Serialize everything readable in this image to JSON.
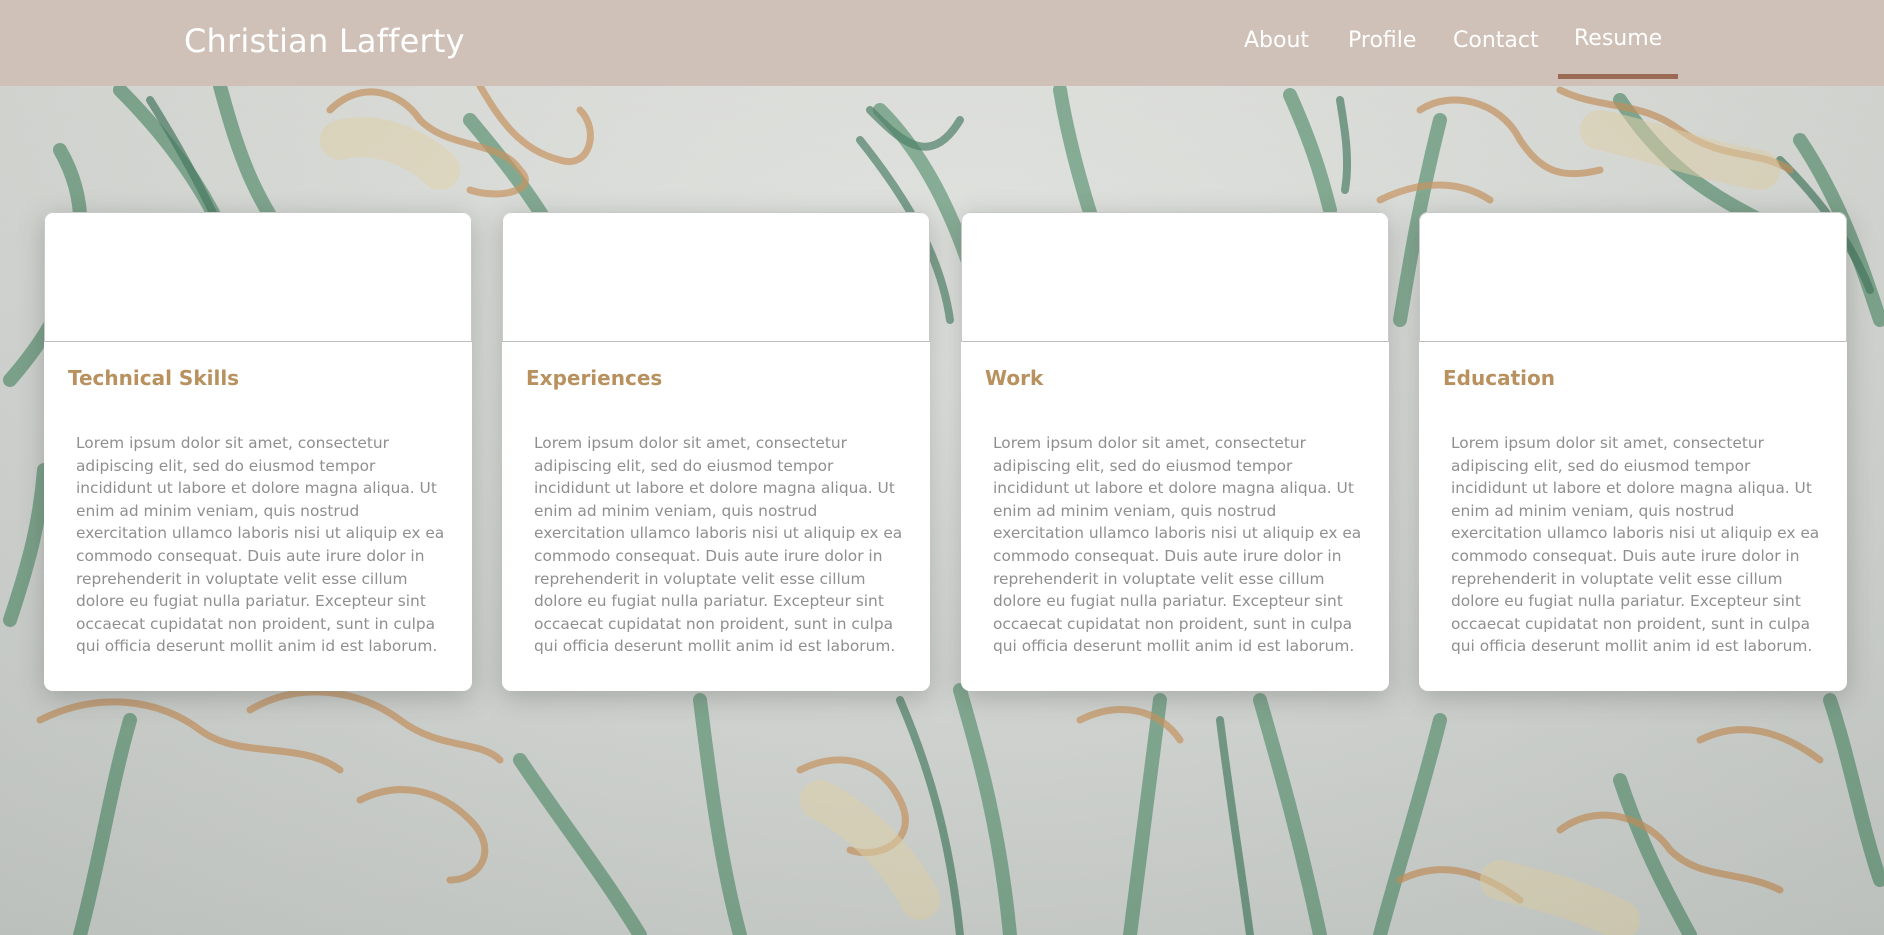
{
  "header": {
    "brand": "Christian Lafferty",
    "nav": [
      {
        "label": "About",
        "active": false
      },
      {
        "label": "Profile",
        "active": false
      },
      {
        "label": "Contact",
        "active": false
      },
      {
        "label": "Resume",
        "active": true
      }
    ]
  },
  "cards": [
    {
      "title": "Technical Skills",
      "body": "Lorem ipsum dolor sit amet, consectetur adipiscing elit, sed do eiusmod tempor incididunt ut labore et dolore magna aliqua. Ut enim ad minim veniam, quis nostrud exercitation ullamco laboris nisi ut aliquip ex ea commodo consequat. Duis aute irure dolor in reprehenderit in voluptate velit esse cillum dolore eu fugiat nulla pariatur. Excepteur sint occaecat cupidatat non proident, sunt in culpa qui officia deserunt mollit anim id est laborum."
    },
    {
      "title": "Experiences",
      "body": "Lorem ipsum dolor sit amet, consectetur adipiscing elit, sed do eiusmod tempor incididunt ut labore et dolore magna aliqua. Ut enim ad minim veniam, quis nostrud exercitation ullamco laboris nisi ut aliquip ex ea commodo consequat. Duis aute irure dolor in reprehenderit in voluptate velit esse cillum dolore eu fugiat nulla pariatur. Excepteur sint occaecat cupidatat non proident, sunt in culpa qui officia deserunt mollit anim id est laborum."
    },
    {
      "title": "Work",
      "body": "Lorem ipsum dolor sit amet, consectetur adipiscing elit, sed do eiusmod tempor incididunt ut labore et dolore magna aliqua. Ut enim ad minim veniam, quis nostrud exercitation ullamco laboris nisi ut aliquip ex ea commodo consequat. Duis aute irure dolor in reprehenderit in voluptate velit esse cillum dolore eu fugiat nulla pariatur. Excepteur sint occaecat cupidatat non proident, sunt in culpa qui officia deserunt mollit anim id est laborum."
    },
    {
      "title": "Education",
      "body": "Lorem ipsum dolor sit amet, consectetur adipiscing elit, sed do eiusmod tempor incididunt ut labore et dolore magna aliqua. Ut enim ad minim veniam, quis nostrud exercitation ullamco laboris nisi ut aliquip ex ea commodo consequat. Duis aute irure dolor in reprehenderit in voluptate velit esse cillum dolore eu fugiat nulla pariatur. Excepteur sint occaecat cupidatat non proident, sunt in culpa qui officia deserunt mollit anim id est laborum."
    }
  ],
  "colors": {
    "header_bg": "#d0c1b8",
    "active_underline": "#9a6a55",
    "card_title": "#b8915f",
    "card_text": "#8f8f8f"
  }
}
